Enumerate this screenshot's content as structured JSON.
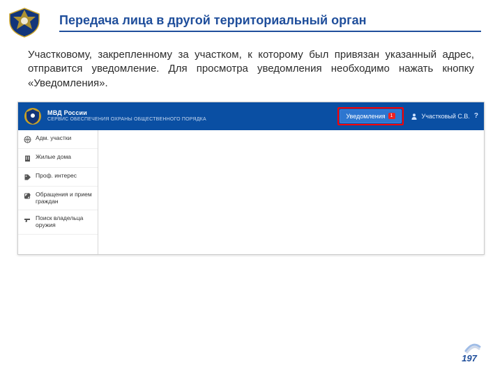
{
  "slide": {
    "title": "Передача лица в другой территориальный орган",
    "description": "Участковому, закрепленному за  участком, к которому был привязан указанный адрес, отправится уведомление. Для просмотра уведомления необходимо нажать кнопку «Уведомления».",
    "page_number": "197"
  },
  "app": {
    "header_title": "МВД России",
    "header_subtitle": "СЕРВИС ОБЕСПЕЧЕНИЯ ОХРАНЫ ОБЩЕСТВЕННОГО ПОРЯДКА",
    "notifications_label": "Уведомления",
    "notifications_badge": "1",
    "user_name": "Участковый С.В.",
    "help_label": "?",
    "sidebar": {
      "items": [
        {
          "label": "Адм. участки",
          "icon": "globe"
        },
        {
          "label": "Жилые дома",
          "icon": "building"
        },
        {
          "label": "Проф. интерес",
          "icon": "tag"
        },
        {
          "label": "Обращения и прием граждан",
          "icon": "edit"
        },
        {
          "label": "Поиск владельца оружия",
          "icon": "gun"
        }
      ]
    }
  }
}
